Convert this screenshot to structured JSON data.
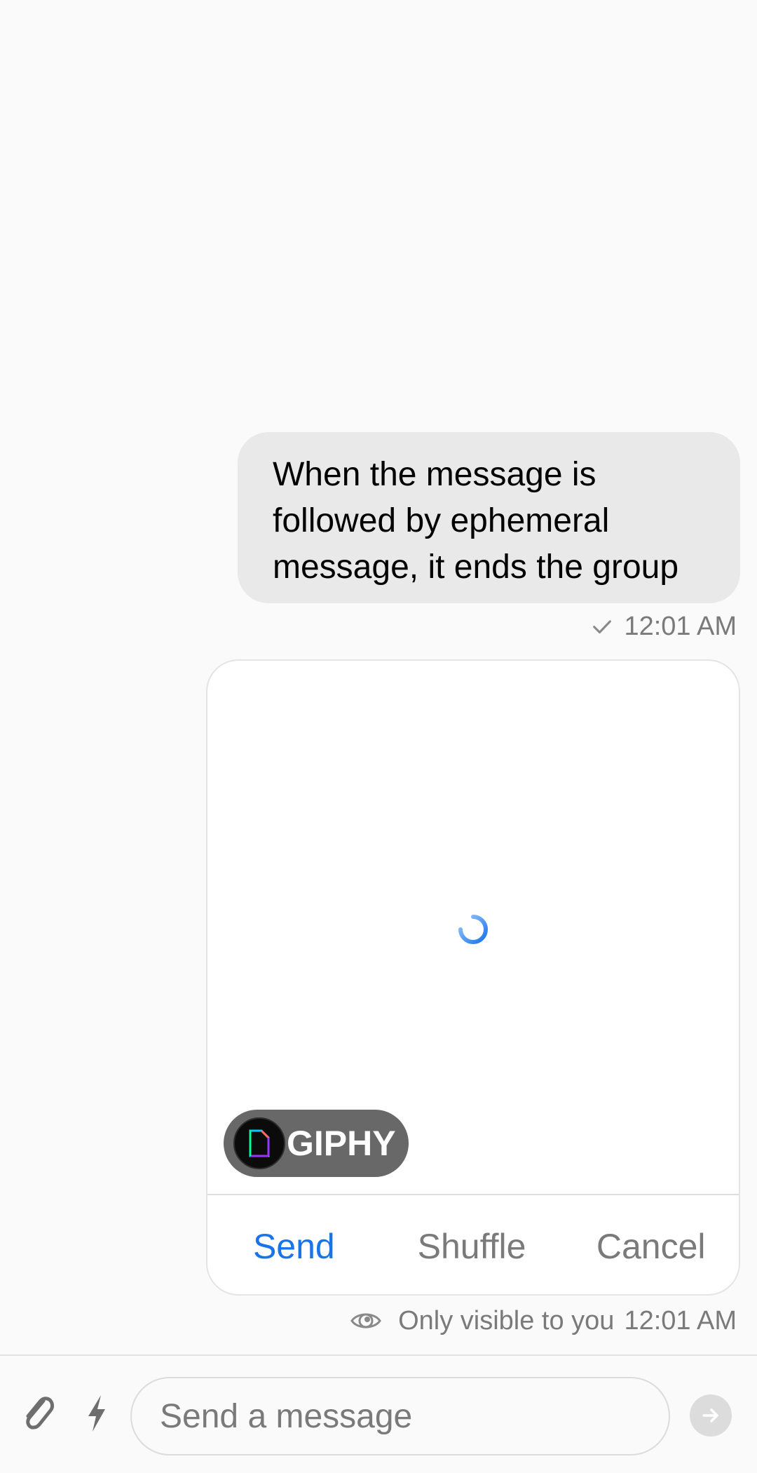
{
  "message": {
    "lines": [
      "When the message is",
      "followed by ephemeral",
      "message, it ends the group"
    ],
    "timestamp": "12:01 AM",
    "status_icon": "check-icon"
  },
  "giphy_card": {
    "badge_label": "GIPHY",
    "loading_icon": "spinner-icon",
    "actions": {
      "send": "Send",
      "shuffle": "Shuffle",
      "cancel": "Cancel"
    },
    "visibility_text": "Only visible to you",
    "timestamp": "12:01 AM"
  },
  "composer": {
    "placeholder": "Send a message",
    "attach_icon": "paperclip-icon",
    "commands_icon": "lightning-icon",
    "send_icon": "arrow-right-icon"
  },
  "colors": {
    "accent": "#1a73e8",
    "bubble": "#e9e9e9",
    "muted_text": "#7a7a7a"
  }
}
